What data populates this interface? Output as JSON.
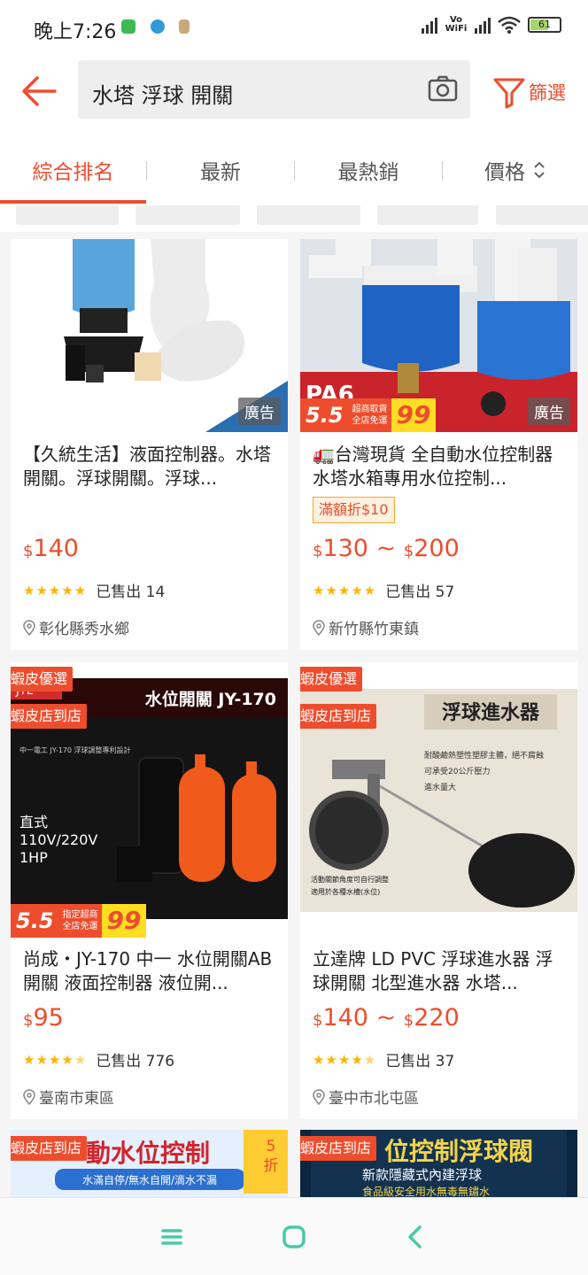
{
  "status_bar": {
    "time": "晚上7:26",
    "network_label": "Vo WiFi",
    "battery": "61",
    "app_icon_colors": [
      "#3cba54",
      "#2f9bd6",
      "#c9a978"
    ]
  },
  "header": {
    "search_query": "水塔 浮球 開關",
    "filter_label": "篩選",
    "accent_color": "#ee4d2d"
  },
  "sort_tabs": [
    {
      "label": "綜合排名",
      "active": true
    },
    {
      "label": "最新",
      "active": false
    },
    {
      "label": "最熱銷",
      "active": false
    },
    {
      "label": "價格",
      "active": false
    }
  ],
  "products": [
    {
      "title": "【久統生活】液面控制器。水塔開關。浮球開關。浮球...",
      "ad_tag": "廣告",
      "price": "140",
      "sold": "已售出 14",
      "location": "彰化縣秀水鄉",
      "stars": 5
    },
    {
      "title": "🚛台灣現貨 全自動水位控制器 水塔水箱專用水位控制...",
      "ad_tag": "廣告",
      "promo": "滿額折$10",
      "price_min": "130",
      "price_max": "200",
      "sold": "已售出 57",
      "location": "新竹縣竹東鎮",
      "stars": 5,
      "image_text": "PA6",
      "flash": {
        "sale": "5.5",
        "line1": "超商取貨",
        "line2": "全店免運",
        "num": "99"
      }
    },
    {
      "badge_1": "蝦皮優選",
      "badge_2": "蝦皮店到店",
      "title": "尚成・JY-170 中一 水位開關AB開關 液面控制器 液位開...",
      "price": "95",
      "sold": "已售出 776",
      "location": "臺南市東區",
      "stars": 4.5,
      "image_heading": "水位開關 JY-170",
      "image_brand": "JYE",
      "image_note": "中一電工 JY-170 浮球調整專利設計",
      "image_spec": [
        "直式",
        "110V/220V",
        "1HP"
      ],
      "flash": {
        "sale": "5.5",
        "line1": "指定超商",
        "line2": "全店免運",
        "num": "99"
      }
    },
    {
      "badge_1": "蝦皮優選",
      "badge_2": "蝦皮店到店",
      "title": "立達牌 LD PVC 浮球進水器 浮球開關 北型進水器 水塔...",
      "price_min": "140",
      "price_max": "220",
      "sold": "已售出 37",
      "location": "臺中市北屯區",
      "stars": 4.5,
      "image_heading": "浮球進水器",
      "image_lines": [
        "耐酸鹼熱塑性塑膠主體，絕不腐蝕",
        "可承受20公斤壓力",
        "進水量大"
      ],
      "image_caption": [
        "活動關節角度可自行調整",
        "適用於各種水槽(水位)"
      ]
    },
    {
      "badge_2": "蝦皮店到店",
      "discount_num": "5",
      "discount_unit": "折",
      "image_heading": "動水位控制",
      "image_sub": "水滿自停/無水自開/滴水不漏"
    },
    {
      "badge_2": "蝦皮店到店",
      "image_heading": "位控制浮球閥",
      "image_sub": "新款隱藏式內建浮球",
      "image_sub2": "食品級安全用水無毒無鏽水"
    }
  ],
  "currency_symbol": "$",
  "range_sep": " ~ "
}
